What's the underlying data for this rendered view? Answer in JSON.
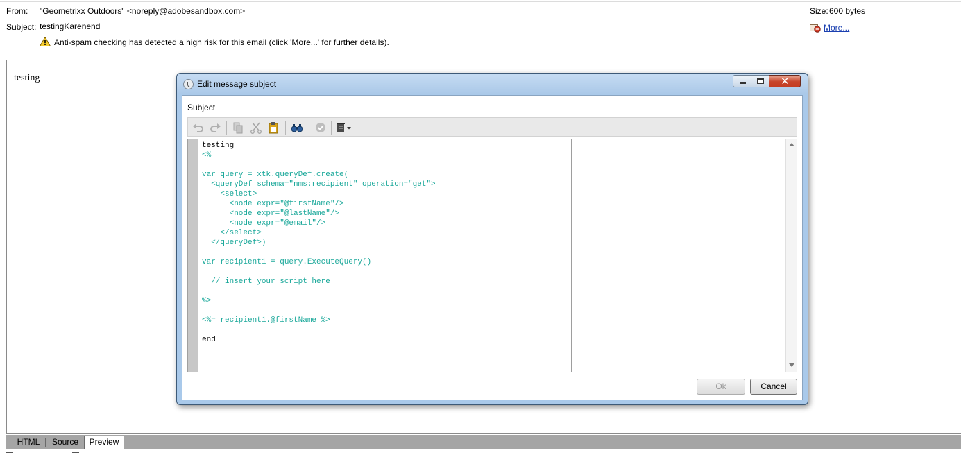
{
  "header": {
    "from_label": "From:",
    "from_value": "\"Geometrixx Outdoors\" <noreply@adobesandbox.com>",
    "subject_label": "Subject:",
    "subject_value": "testingKarenend",
    "warning_text": "Anti-spam checking has detected a high risk for this email (click 'More...' for further details).",
    "size_label": "Size:",
    "size_value": "600 bytes",
    "more_link": "More..."
  },
  "preview": {
    "body_text": "testing"
  },
  "tabs": [
    {
      "label": "HTML"
    },
    {
      "label": "Source"
    },
    {
      "label": "Preview"
    }
  ],
  "dialog": {
    "title": "Edit message subject",
    "section_label": "Subject",
    "toolbar": [
      "undo-icon",
      "redo-icon",
      "copy-icon",
      "cut-icon",
      "paste-icon",
      "find-icon",
      "validate-icon",
      "insert-menu-icon"
    ],
    "code_lines": [
      "testing",
      "<%",
      "",
      "var query = xtk.queryDef.create(",
      "  <queryDef schema=\"nms:recipient\" operation=\"get\">",
      "    <select>",
      "      <node expr=\"@firstName\"/>",
      "      <node expr=\"@lastName\"/>",
      "      <node expr=\"@email\"/>",
      "    </select>",
      "  </queryDef>)",
      "",
      "var recipient1 = query.ExecuteQuery()",
      "",
      "  // insert your script here",
      "",
      "%>",
      "",
      "<%= recipient1.@firstName %>",
      "",
      "end"
    ],
    "ok_label": "Ok",
    "cancel_label": "Cancel"
  },
  "colors": {
    "code_teal": "#1aa89a",
    "link_blue": "#1a3fb0",
    "dialog_frame": "#a9c9ea",
    "close_red": "#c7442a"
  }
}
